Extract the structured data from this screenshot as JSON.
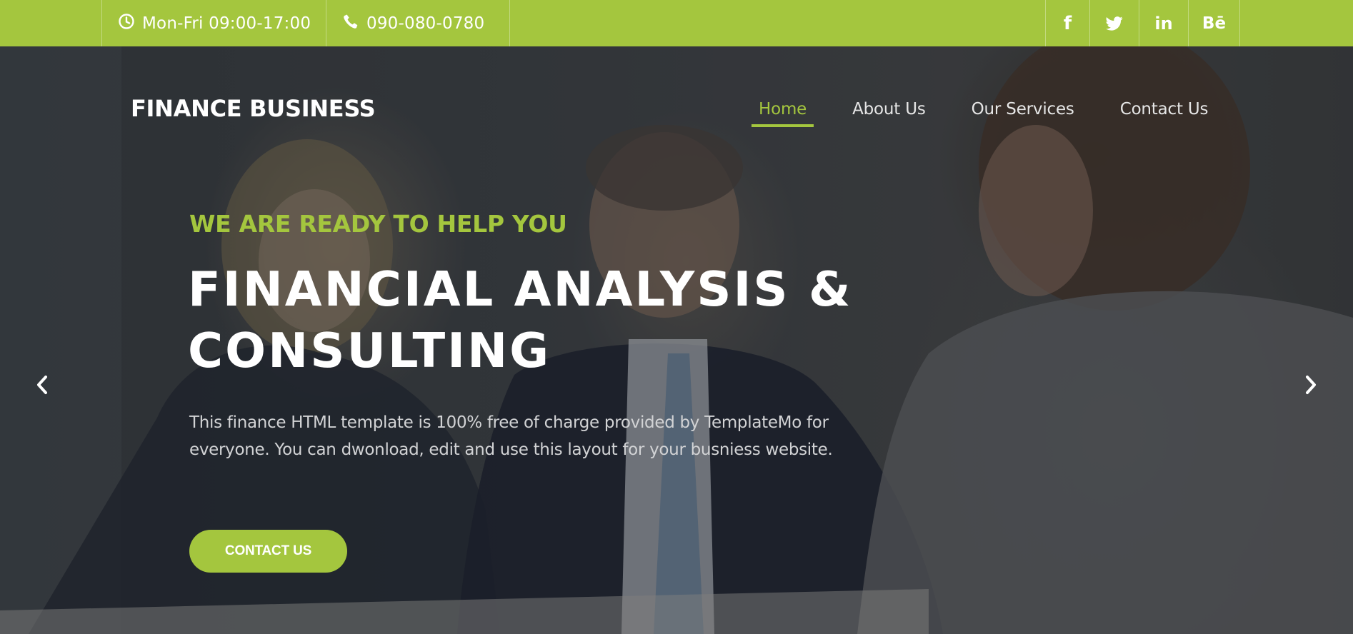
{
  "topbar": {
    "hours": "Mon-Fri 09:00-17:00",
    "phone": "090-080-0780",
    "socials": {
      "facebook": "f",
      "twitter": "twitter-icon",
      "linkedin": "in",
      "behance": "Bē"
    }
  },
  "header": {
    "brand": "FINANCE BUSINESS",
    "nav": [
      {
        "label": "Home",
        "active": true
      },
      {
        "label": "About Us"
      },
      {
        "label": "Our Services"
      },
      {
        "label": "Contact Us"
      }
    ]
  },
  "hero": {
    "eyebrow": "WE ARE READY TO HELP YOU",
    "headline_line1": "FINANCIAL ANALYSIS &",
    "headline_line2": "CONSULTING",
    "description": "This finance HTML template is 100% free of charge provided by TemplateMo for everyone. You can dwonload, edit and use this layout for your busniess website.",
    "cta_label": "CONTACT US"
  },
  "colors": {
    "accent": "#a4c63e",
    "text_light": "#ffffff",
    "text_muted": "#d2d3d5"
  },
  "icons": {
    "hours": "clock-icon",
    "phone": "phone-icon",
    "prev": "chevron-left-icon",
    "next": "chevron-right-icon"
  }
}
